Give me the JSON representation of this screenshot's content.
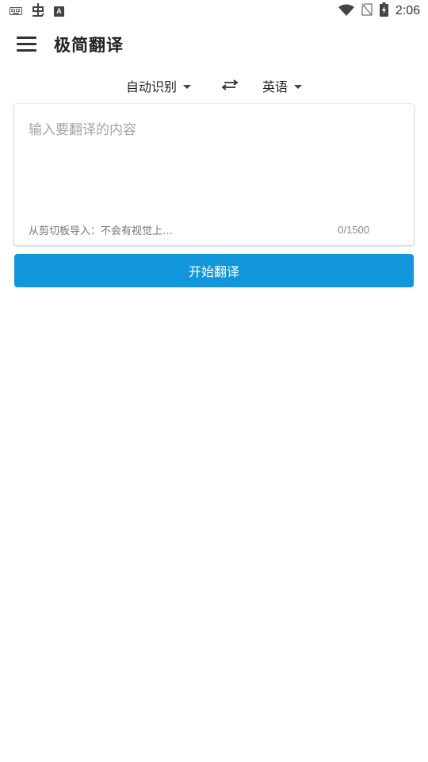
{
  "status_bar": {
    "time": "2:06",
    "left_icons": [
      "keyboard-icon",
      "bug-icon",
      "a-box-icon"
    ],
    "right_icons": [
      "wifi-icon",
      "no-sim-icon",
      "battery-charging-icon"
    ]
  },
  "app_bar": {
    "title": "极简翻译"
  },
  "languages": {
    "source": "自动识别",
    "target": "英语"
  },
  "input": {
    "placeholder": "输入要翻译的内容",
    "value": "",
    "clipboard_hint": "从剪切板导入：不会有视觉上…",
    "char_count": "0/1500"
  },
  "actions": {
    "translate_label": "开始翻译"
  },
  "colors": {
    "accent": "#1296db",
    "background": "#ffffff"
  }
}
